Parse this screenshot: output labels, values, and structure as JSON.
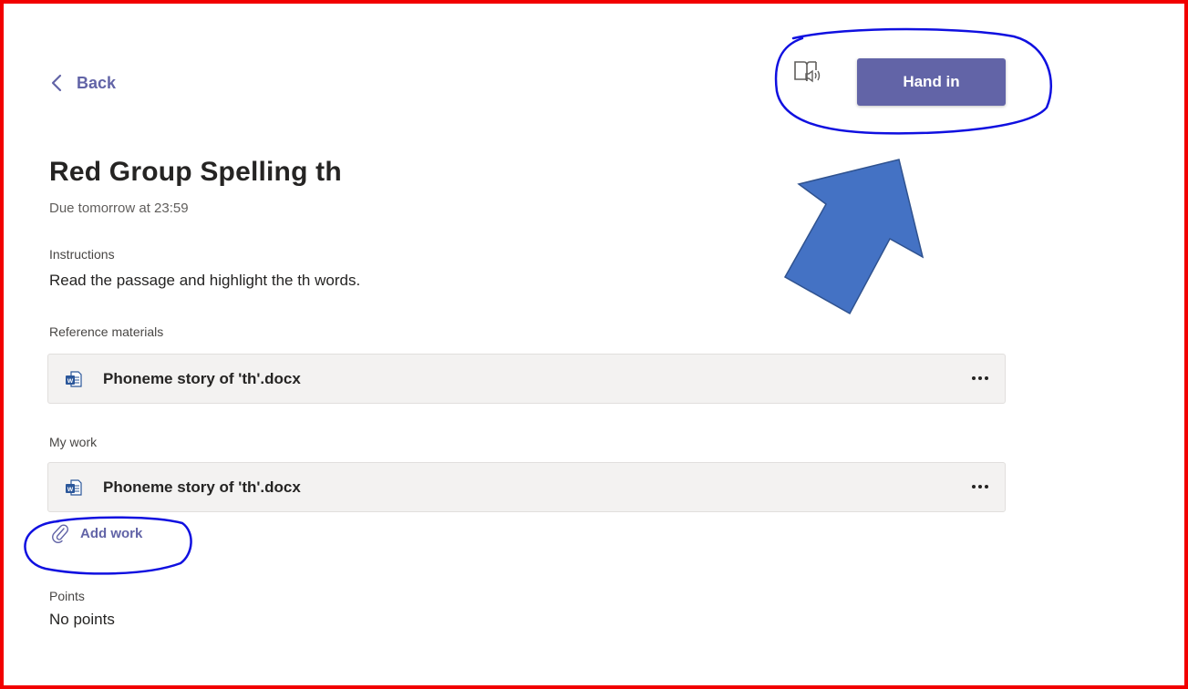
{
  "nav": {
    "back_label": "Back"
  },
  "toolbar": {
    "immersive_reader_icon": "immersive-reader-icon",
    "hand_in_label": "Hand in"
  },
  "assignment": {
    "title": "Red Group Spelling th",
    "due": "Due tomorrow at 23:59",
    "instructions_label": "Instructions",
    "instructions_text": "Read the passage and highlight the  th words.",
    "reference_label": "Reference materials",
    "reference_files": [
      {
        "name": "Phoneme story of 'th'.docx",
        "icon": "word-doc-icon"
      }
    ],
    "my_work_label": "My work",
    "my_work_files": [
      {
        "name": "Phoneme story of 'th'.docx",
        "icon": "word-doc-icon"
      }
    ],
    "add_work_label": "Add work",
    "points_label": "Points",
    "points_value": "No points"
  },
  "colors": {
    "accent": "#6264a7",
    "frame_border": "#f20000",
    "annotation_ink": "#1010e0",
    "arrow_fill": "#4472c4",
    "arrow_stroke": "#2f528f",
    "word_icon": "#2b579a"
  }
}
